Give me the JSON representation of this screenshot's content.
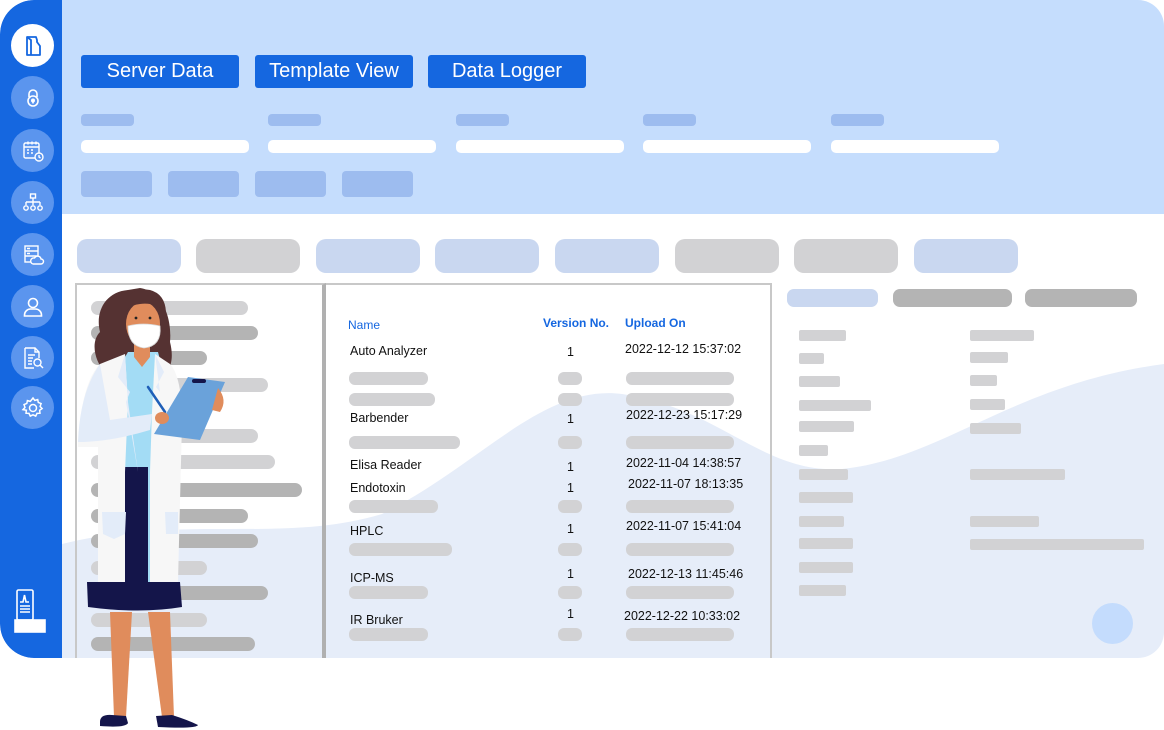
{
  "colors": {
    "brand_blue": "#1567e0",
    "header_bg": "#c5ddfd",
    "placeholder_blue": "#9dbcef",
    "placeholder_grey": "#d2d2d4",
    "wave_bg": "#e6edf9"
  },
  "sidebar": {
    "items": [
      {
        "icon": "folder-icon",
        "active": true
      },
      {
        "icon": "lock-icon",
        "active": false
      },
      {
        "icon": "calendar-clock-icon",
        "active": false
      },
      {
        "icon": "hierarchy-icon",
        "active": false
      },
      {
        "icon": "server-cloud-icon",
        "active": false
      },
      {
        "icon": "user-icon",
        "active": false
      },
      {
        "icon": "document-search-icon",
        "active": false
      },
      {
        "icon": "settings-icon",
        "active": false
      }
    ],
    "bottom_icon": "device-report-icon"
  },
  "header": {
    "tabs": [
      {
        "label": "Server Data"
      },
      {
        "label": "Template View"
      },
      {
        "label": "Data Logger"
      }
    ]
  },
  "table": {
    "columns": {
      "name": "Name",
      "version": "Version No.",
      "upload": "Upload On"
    },
    "rows": [
      {
        "name": "Auto Analyzer",
        "version": "1",
        "upload": "2022-12-12 15:37:02"
      },
      {
        "name": "Barbender",
        "version": "1",
        "upload": "2022-12-23 15:17:29"
      },
      {
        "name": "Elisa Reader",
        "version": "1",
        "upload": "2022-11-04 14:38:57"
      },
      {
        "name": "Endotoxin",
        "version": "1",
        "upload": "2022-11-07 18:13:35"
      },
      {
        "name": "HPLC",
        "version": "1",
        "upload": "2022-11-07 15:41:04"
      },
      {
        "name": "ICP-MS",
        "version": "1",
        "upload": "2022-12-13 11:45:46"
      },
      {
        "name": "IR Bruker",
        "version": "1",
        "upload": "2022-12-22 10:33:02"
      }
    ]
  }
}
